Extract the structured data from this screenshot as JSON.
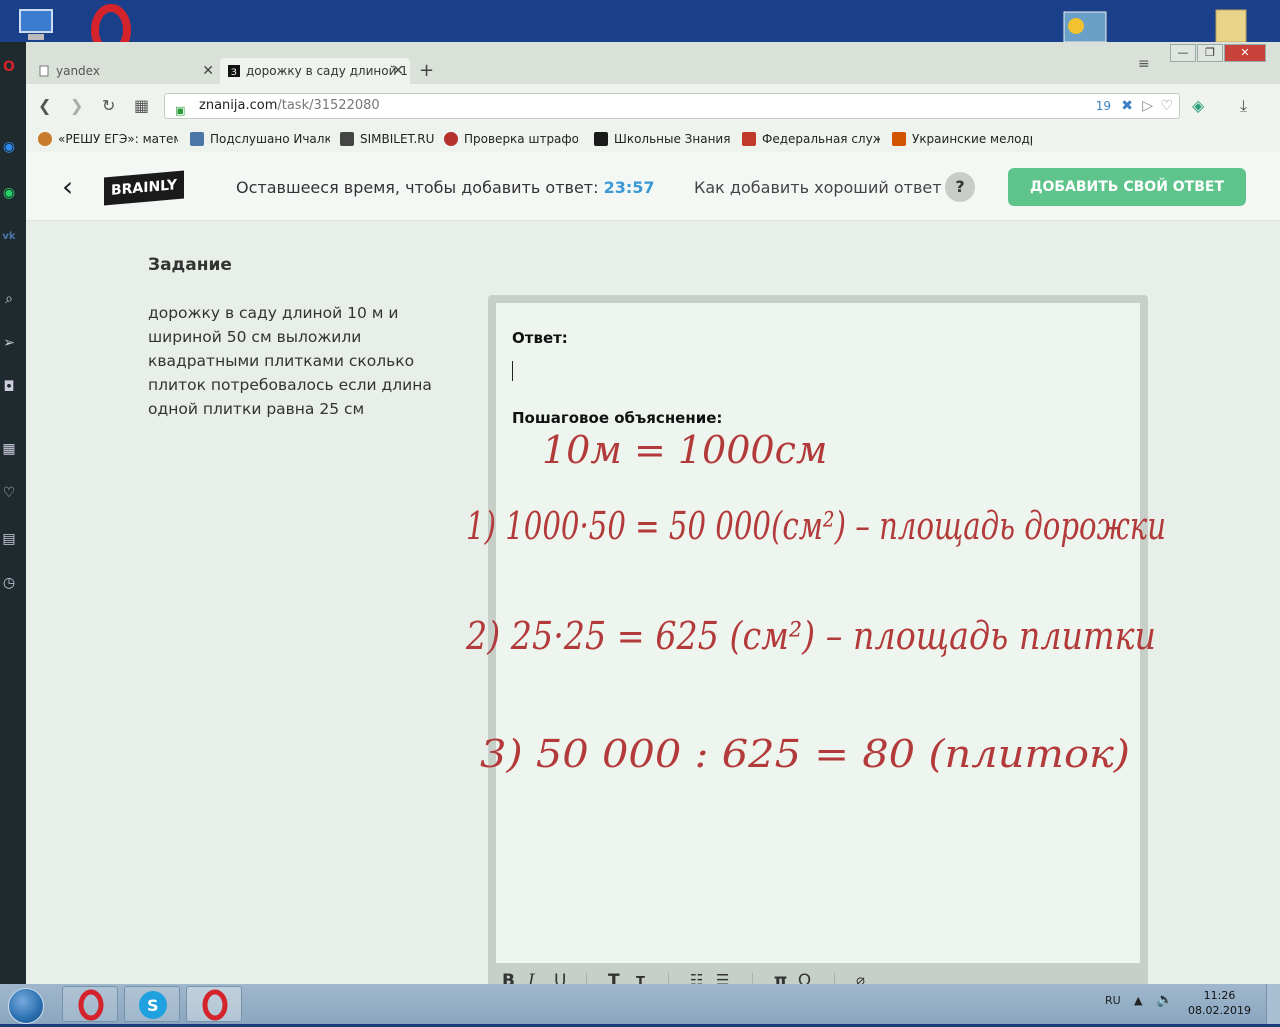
{
  "tabs": [
    {
      "label": "yandex"
    },
    {
      "label": "дорожку в саду длиной 1"
    }
  ],
  "address": {
    "domain": "znanija.com",
    "path": "/task/31522080",
    "badge_count": "19"
  },
  "bookmarks": [
    {
      "label": "«РЕШУ ЕГЭ»: матема",
      "color": "#c97b2c"
    },
    {
      "label": "Подслушано Ичалки",
      "color": "#4a76a8"
    },
    {
      "label": "SIMBILET.RU",
      "color": "#444444"
    },
    {
      "label": "Проверка штрафов",
      "color": "#b5312b"
    },
    {
      "label": "Школьные Знания.co",
      "color": "#1a1a1a"
    },
    {
      "label": "Федеральная служба",
      "color": "#c0392b"
    },
    {
      "label": "Украинские мелодра",
      "color": "#d35400"
    }
  ],
  "header": {
    "logo": "BRAINLY",
    "timer_label": "Оставшееся время, чтобы добавить ответ: ",
    "timer_value": "23:57",
    "howto": "Как добавить хороший ответ",
    "help": "?",
    "add_button": "ДОБАВИТЬ СВОЙ ОТВЕТ"
  },
  "task": {
    "title": "Задание",
    "text": "дорожку в саду длиной 10 м и шириной 50 см выложили квадратными плитками сколько плиток потребовалось если длина одной плитки равна 25 см"
  },
  "editor": {
    "answer_label": "Ответ:",
    "step_label": "Пошаговое объяснение:",
    "handwriting": [
      "10м = 1000см",
      "1) 1000·50 = 50 000(см²) – площадь дорожки",
      "2) 25·25 = 625 (см²) – площадь плитки",
      "3) 50 000 : 625 = 80 (плиток)"
    ],
    "toolbar": [
      "B",
      "I",
      "U",
      "T",
      "T",
      "list-numbered",
      "list-bulleted",
      "π",
      "Ω",
      "attach"
    ]
  },
  "taskbar": {
    "lang": "RU",
    "time": "11:26",
    "date": "08.02.2019"
  },
  "colors": {
    "accent_green": "#5fc48c",
    "timer_blue": "#3b9ad6",
    "ink": "#b23a3a"
  }
}
